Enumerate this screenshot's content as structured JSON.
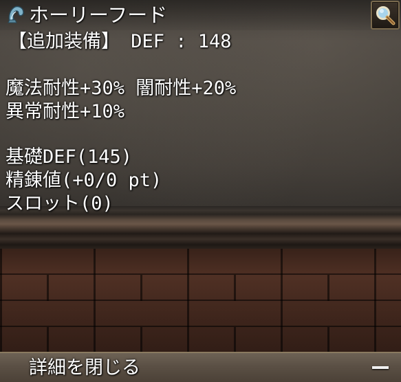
{
  "title": "ホーリーフード",
  "details": {
    "equip_line": "【追加装備】 DEF : 148",
    "resist_line_1": "魔法耐性+30% 闇耐性+20%",
    "resist_line_2": "異常耐性+10%",
    "base_def": "基礎DEF(145)",
    "refine": "精錬値(+0/0 pt)",
    "slot": "スロット(0)"
  },
  "footer": {
    "close_label": "詳細を閉じる"
  },
  "icons": {
    "item": "hood-item-icon",
    "search": "magnifier-icon",
    "collapse": "minus-icon"
  },
  "colors": {
    "text": "#ffffff",
    "footer_bg": "#5a4f44",
    "search_border": "#7a6a4e"
  }
}
